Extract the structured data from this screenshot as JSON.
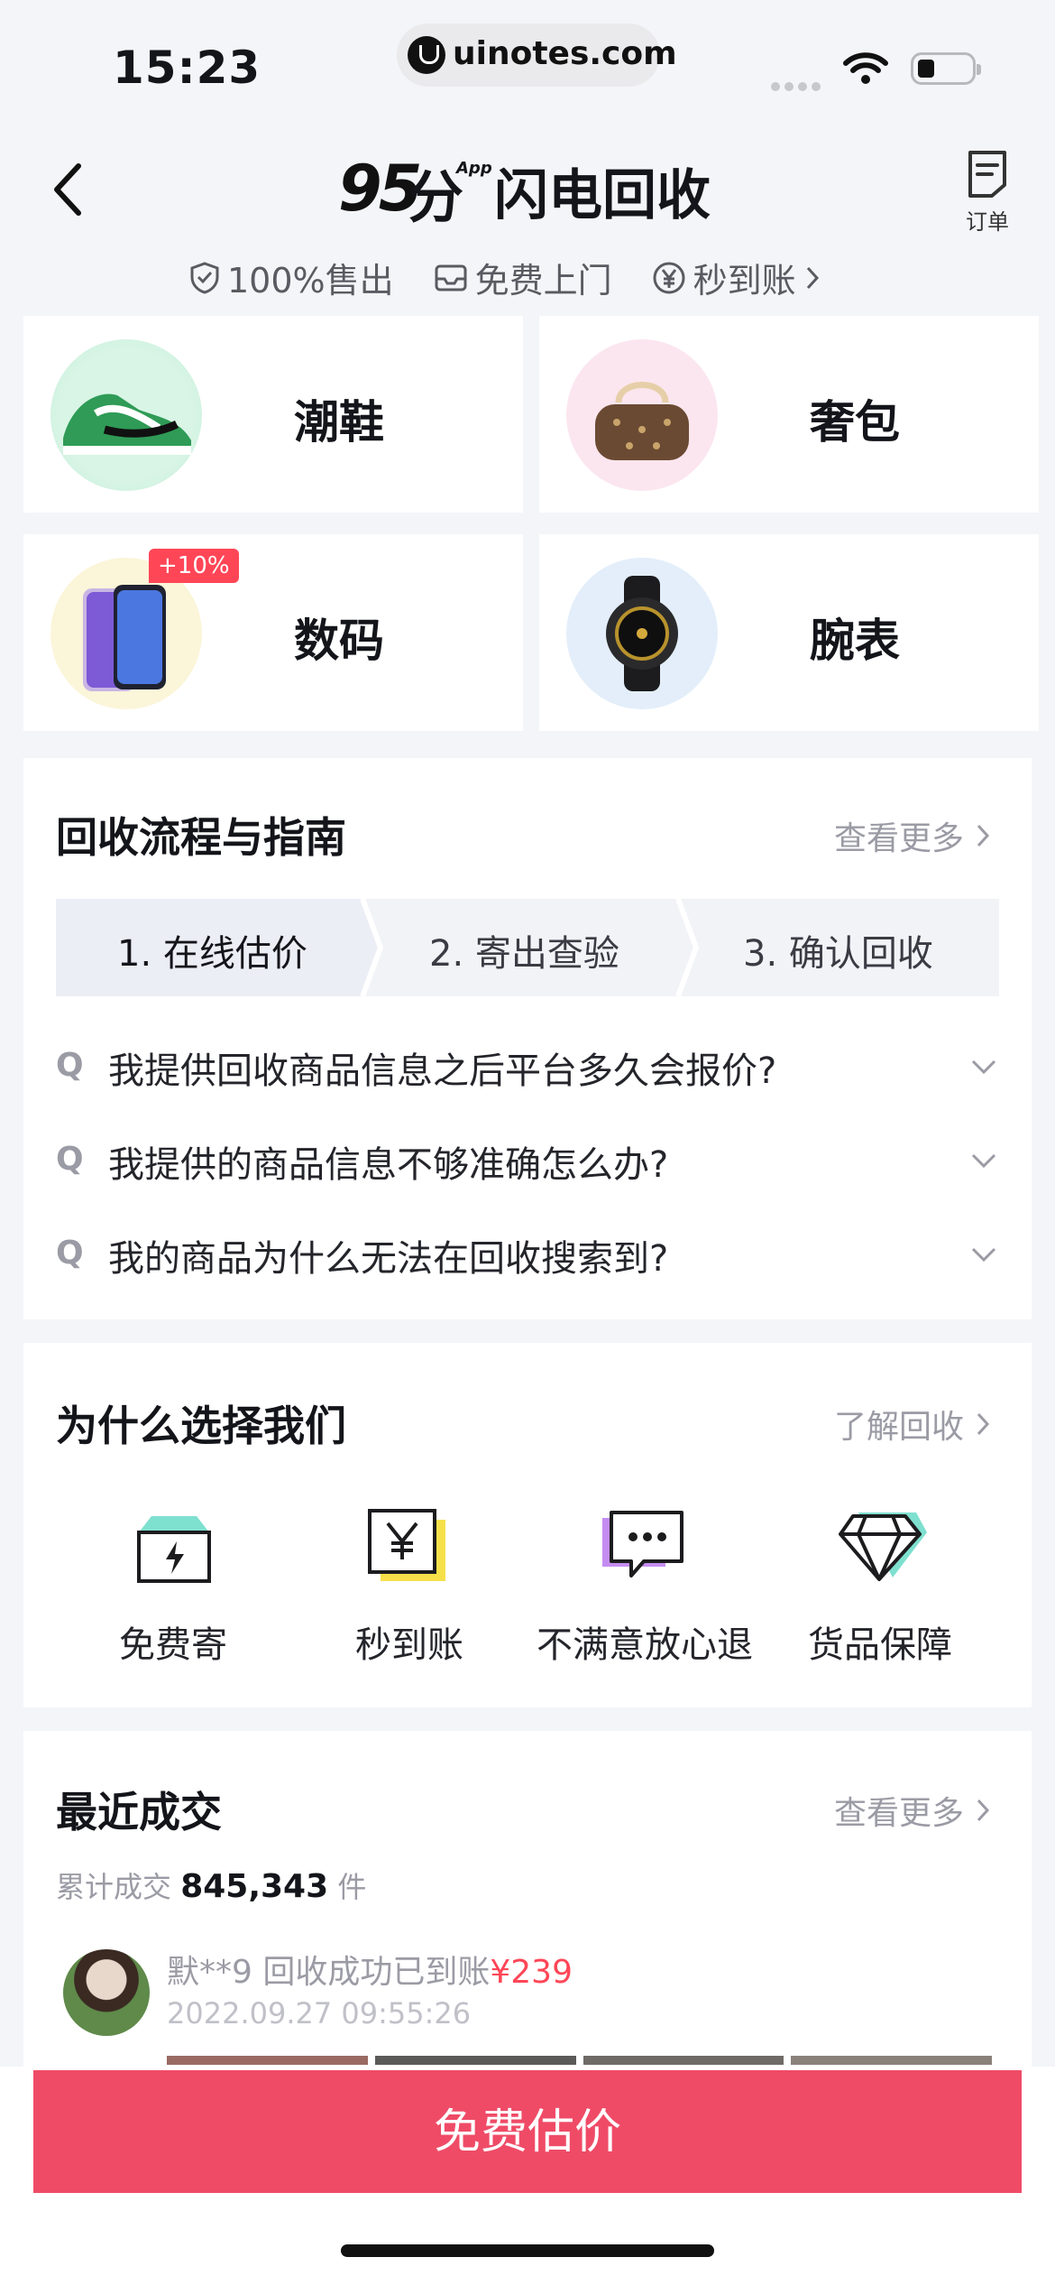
{
  "status_bar": {
    "time": "15:23",
    "url": "uinotes.com"
  },
  "header": {
    "logo_number": "95",
    "logo_app": "App",
    "logo_fen": "分",
    "title": "闪电回收",
    "order_label": "订单",
    "badges": [
      "100%售出",
      "免费上门",
      "秒到账"
    ]
  },
  "categories": [
    {
      "label": "潮鞋"
    },
    {
      "label": "奢包"
    },
    {
      "label": "数码",
      "tag": "+10%"
    },
    {
      "label": "腕表"
    }
  ],
  "guide": {
    "title": "回收流程与指南",
    "more": "查看更多",
    "steps": [
      "1. 在线估价",
      "2. 寄出查验",
      "3. 确认回收"
    ],
    "faq_marker": "Q",
    "faqs": [
      "我提供回收商品信息之后平台多久会报价?",
      "我提供的商品信息不够准确怎么办?",
      "我的商品为什么无法在回收搜索到?"
    ]
  },
  "why": {
    "title": "为什么选择我们",
    "more": "了解回收",
    "items": [
      {
        "label": "免费寄",
        "icon": "box-lightning-icon"
      },
      {
        "label": "秒到账",
        "icon": "yen-card-icon"
      },
      {
        "label": "不满意放心退",
        "icon": "chat-bubble-icon"
      },
      {
        "label": "货品保障",
        "icon": "diamond-icon"
      }
    ]
  },
  "recent": {
    "title": "最近成交",
    "more": "查看更多",
    "total_prefix": "累计成交",
    "total_count": "845,343",
    "total_suffix": "件",
    "deal": {
      "user_text": "默**9 回收成功已到账",
      "price": "¥239",
      "time": "2022.09.27 09:55:26"
    }
  },
  "cta": {
    "label": "免费估价"
  },
  "colors": {
    "accent": "#ef4b67",
    "tag": "#ff4657",
    "brand_green": "#01c2c3"
  }
}
